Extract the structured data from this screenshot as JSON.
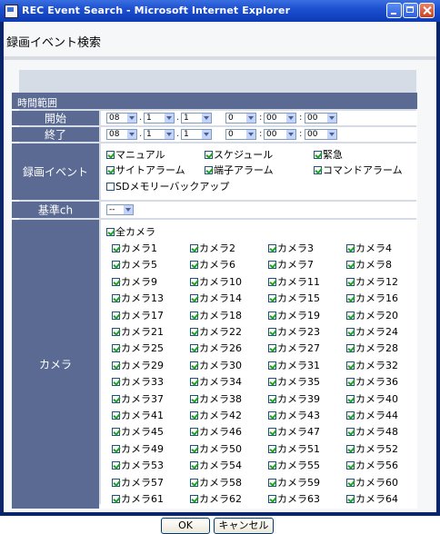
{
  "window": {
    "title": "REC Event Search - Microsoft Internet Explorer"
  },
  "page": {
    "heading": "録画イベント検索"
  },
  "time_range": {
    "header": "時間範囲",
    "start": {
      "label": "開始",
      "year": "08",
      "month": "1",
      "day": "1",
      "hour": "0",
      "minute": "00",
      "second": "00"
    },
    "end": {
      "label": "終了",
      "year": "08",
      "month": "1",
      "day": "1",
      "hour": "0",
      "minute": "00",
      "second": "00"
    },
    "date_sep": ".",
    "time_sep": ":"
  },
  "event": {
    "label": "録画イベント",
    "items": [
      {
        "label": "マニュアル",
        "checked": true
      },
      {
        "label": "スケジュール",
        "checked": true
      },
      {
        "label": "緊急",
        "checked": true
      },
      {
        "label": "サイトアラーム",
        "checked": true
      },
      {
        "label": "端子アラーム",
        "checked": true
      },
      {
        "label": "コマンドアラーム",
        "checked": true
      },
      {
        "label": "SDメモリーバックアップ",
        "checked": false
      }
    ]
  },
  "base_ch": {
    "label": "基準ch",
    "value": "--"
  },
  "camera": {
    "label": "カメラ",
    "all_label": "全カメラ",
    "prefix": "カメラ",
    "count": 64
  },
  "buttons": {
    "ok": "OK",
    "cancel": "キャンセル"
  }
}
